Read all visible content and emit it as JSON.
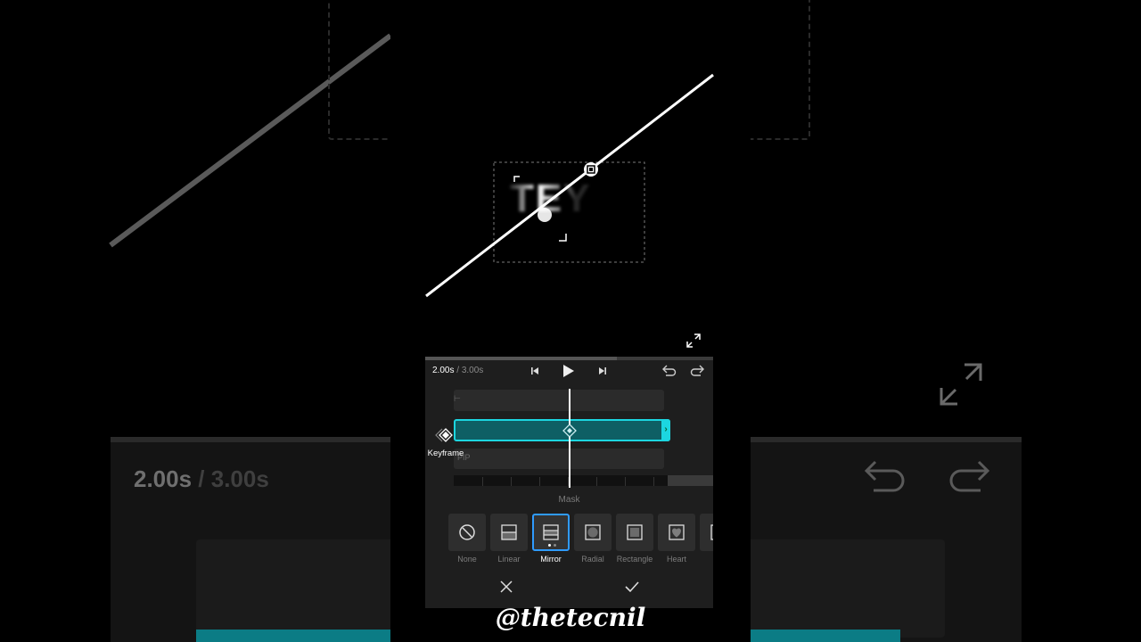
{
  "playback": {
    "current_time": "2.00s",
    "separator": " / ",
    "total_time": "3.00s"
  },
  "preview": {
    "clip_text": "TEY"
  },
  "timeline": {
    "top_track_label": "⊢",
    "bottom_track_label": "PIP",
    "keyframe_label": "Keyframe"
  },
  "mask": {
    "title": "Mask",
    "options": [
      {
        "label": "None",
        "icon": "circle-slash-icon"
      },
      {
        "label": "Linear",
        "icon": "linear-mask-icon"
      },
      {
        "label": "Mirror",
        "icon": "mirror-mask-icon",
        "selected": true
      },
      {
        "label": "Radial",
        "icon": "radial-mask-icon"
      },
      {
        "label": "Rectangle",
        "icon": "rectangle-mask-icon"
      },
      {
        "label": "Heart",
        "icon": "heart-mask-icon"
      }
    ]
  },
  "watermark": "@thetecnil",
  "colors": {
    "accent": "#1cd6e0",
    "selected_border": "#2f9bff",
    "panel": "#1e1e1e"
  }
}
